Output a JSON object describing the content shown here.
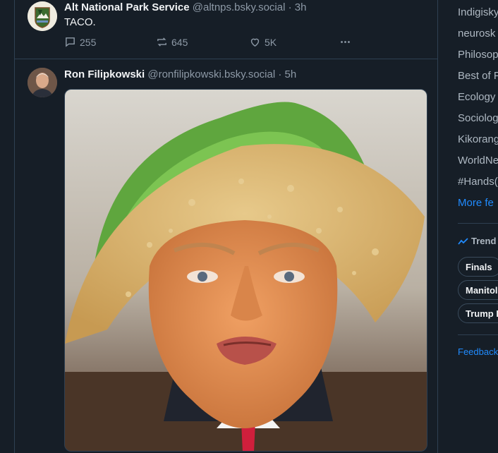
{
  "posts": [
    {
      "display_name": "Alt National Park Service",
      "handle": "@altnps.bsky.social",
      "separator": "·",
      "time": "3h",
      "text": "TACO.",
      "replies": "255",
      "reposts": "645",
      "likes": "5K"
    },
    {
      "display_name": "Ron Filipkowski",
      "handle": "@ronfilipkowski.bsky.social",
      "separator": "·",
      "time": "5h"
    }
  ],
  "sidebar": {
    "feeds": [
      "Indigisky",
      "neurosk",
      "Philosop",
      "Best of F",
      "Ecology",
      "Sociolog",
      "Kikorang",
      "WorldNe",
      "#Hands("
    ],
    "more_feeds": "More fe",
    "trending_title": "Trend",
    "trending": [
      "Finals",
      "Manitol",
      "Trump I"
    ],
    "feedback": "Feedback"
  },
  "colors": {
    "background": "#161e27",
    "accent": "#208bfe",
    "muted": "#8d99a6",
    "border": "#2e4052"
  }
}
